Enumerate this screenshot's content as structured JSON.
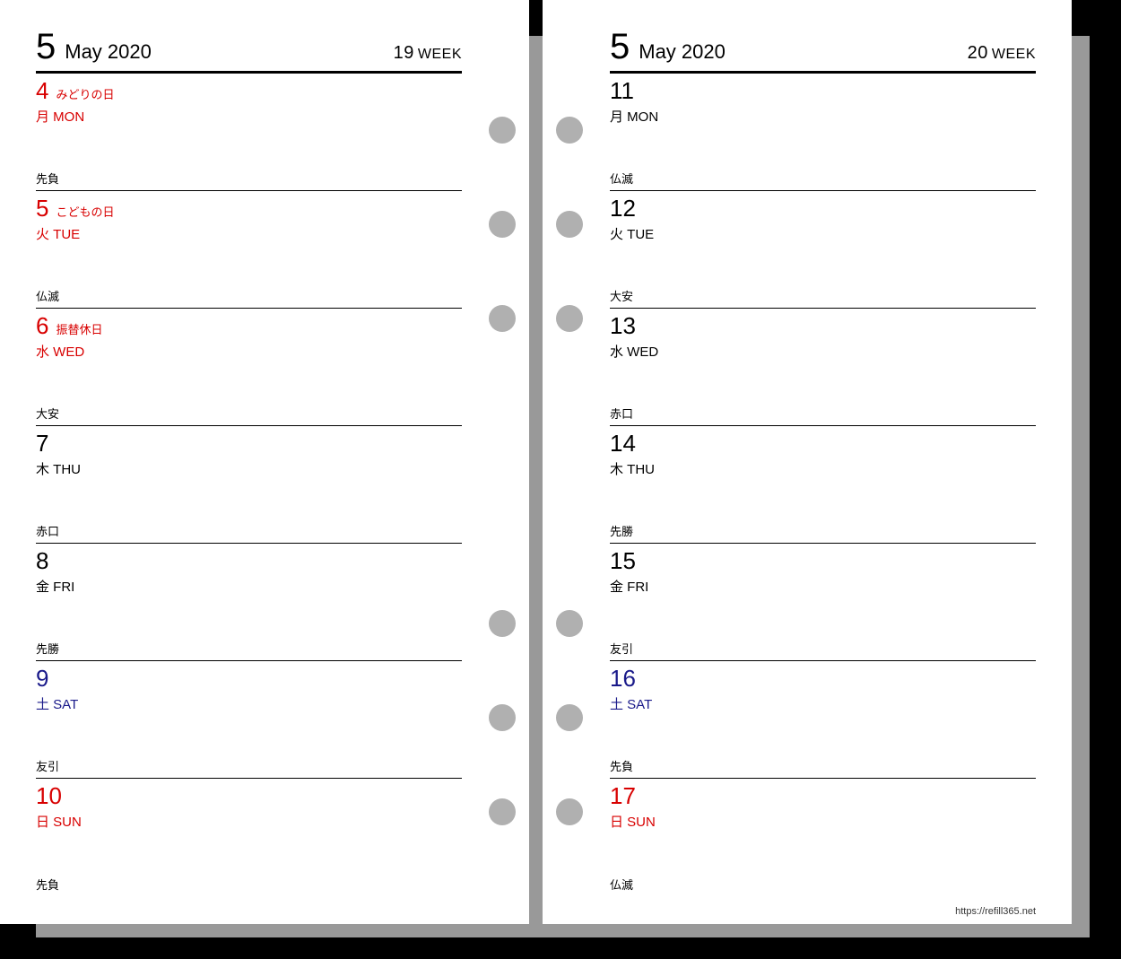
{
  "hole_positions": [
    130,
    235,
    340,
    680,
    785,
    890
  ],
  "left": {
    "month_num": "5",
    "month_text": "May 2020",
    "week_num": "19",
    "week_word": "WEEK",
    "days": [
      {
        "num": "4",
        "holiday": "みどりの日",
        "dow": "月 MON",
        "rokuyou": "先負",
        "color": "c-red"
      },
      {
        "num": "5",
        "holiday": "こどもの日",
        "dow": "火 TUE",
        "rokuyou": "仏滅",
        "color": "c-red"
      },
      {
        "num": "6",
        "holiday": "振替休日",
        "dow": "水 WED",
        "rokuyou": "大安",
        "color": "c-red"
      },
      {
        "num": "7",
        "holiday": "",
        "dow": "木 THU",
        "rokuyou": "赤口",
        "color": "c-black"
      },
      {
        "num": "8",
        "holiday": "",
        "dow": "金 FRI",
        "rokuyou": "先勝",
        "color": "c-black"
      },
      {
        "num": "9",
        "holiday": "",
        "dow": "土 SAT",
        "rokuyou": "友引",
        "color": "c-blue"
      },
      {
        "num": "10",
        "holiday": "",
        "dow": "日 SUN",
        "rokuyou": "先負",
        "color": "c-red"
      }
    ]
  },
  "right": {
    "month_num": "5",
    "month_text": "May 2020",
    "week_num": "20",
    "week_word": "WEEK",
    "footer_url": "https://refill365.net",
    "days": [
      {
        "num": "11",
        "holiday": "",
        "dow": "月 MON",
        "rokuyou": "仏滅",
        "color": "c-black"
      },
      {
        "num": "12",
        "holiday": "",
        "dow": "火 TUE",
        "rokuyou": "大安",
        "color": "c-black"
      },
      {
        "num": "13",
        "holiday": "",
        "dow": "水 WED",
        "rokuyou": "赤口",
        "color": "c-black"
      },
      {
        "num": "14",
        "holiday": "",
        "dow": "木 THU",
        "rokuyou": "先勝",
        "color": "c-black"
      },
      {
        "num": "15",
        "holiday": "",
        "dow": "金 FRI",
        "rokuyou": "友引",
        "color": "c-black"
      },
      {
        "num": "16",
        "holiday": "",
        "dow": "土 SAT",
        "rokuyou": "先負",
        "color": "c-blue"
      },
      {
        "num": "17",
        "holiday": "",
        "dow": "日 SUN",
        "rokuyou": "仏滅",
        "color": "c-red"
      }
    ]
  }
}
